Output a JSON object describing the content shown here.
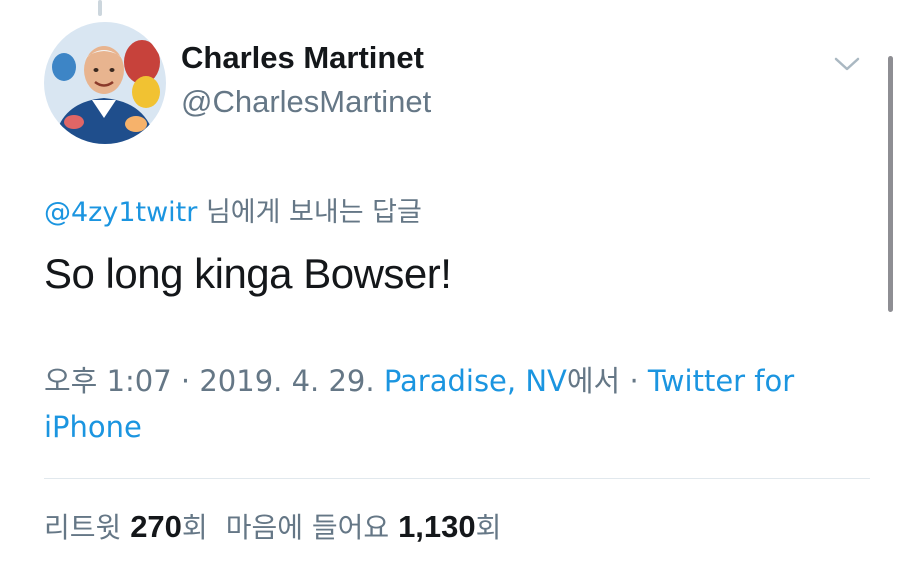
{
  "tweet": {
    "author": {
      "display_name": "Charles Martinet",
      "handle": "@CharlesMartinet",
      "avatar": "avatar-photo"
    },
    "menu_icon": "chevron-down-icon",
    "reply_context": {
      "mention": "@4zy1twitr",
      "suffix": " 님에게 보내는 답글"
    },
    "text": "So long kinga Bowser!",
    "meta": {
      "time_date": "오후 1:07 · 2019. 4. 29. ",
      "location": "Paradise, NV",
      "location_suffix": "에서 · ",
      "source": "Twitter for iPhone"
    },
    "stats": {
      "retweets_label": "리트윗 ",
      "retweets_count": "270",
      "retweets_unit": "회",
      "likes_label": "마음에 들어요 ",
      "likes_count": "1,130",
      "likes_unit": "회"
    },
    "colors": {
      "link": "#1b95e0",
      "secondary_text": "#657786",
      "primary_text": "#14171a",
      "divider": "#e1e8ed"
    }
  }
}
